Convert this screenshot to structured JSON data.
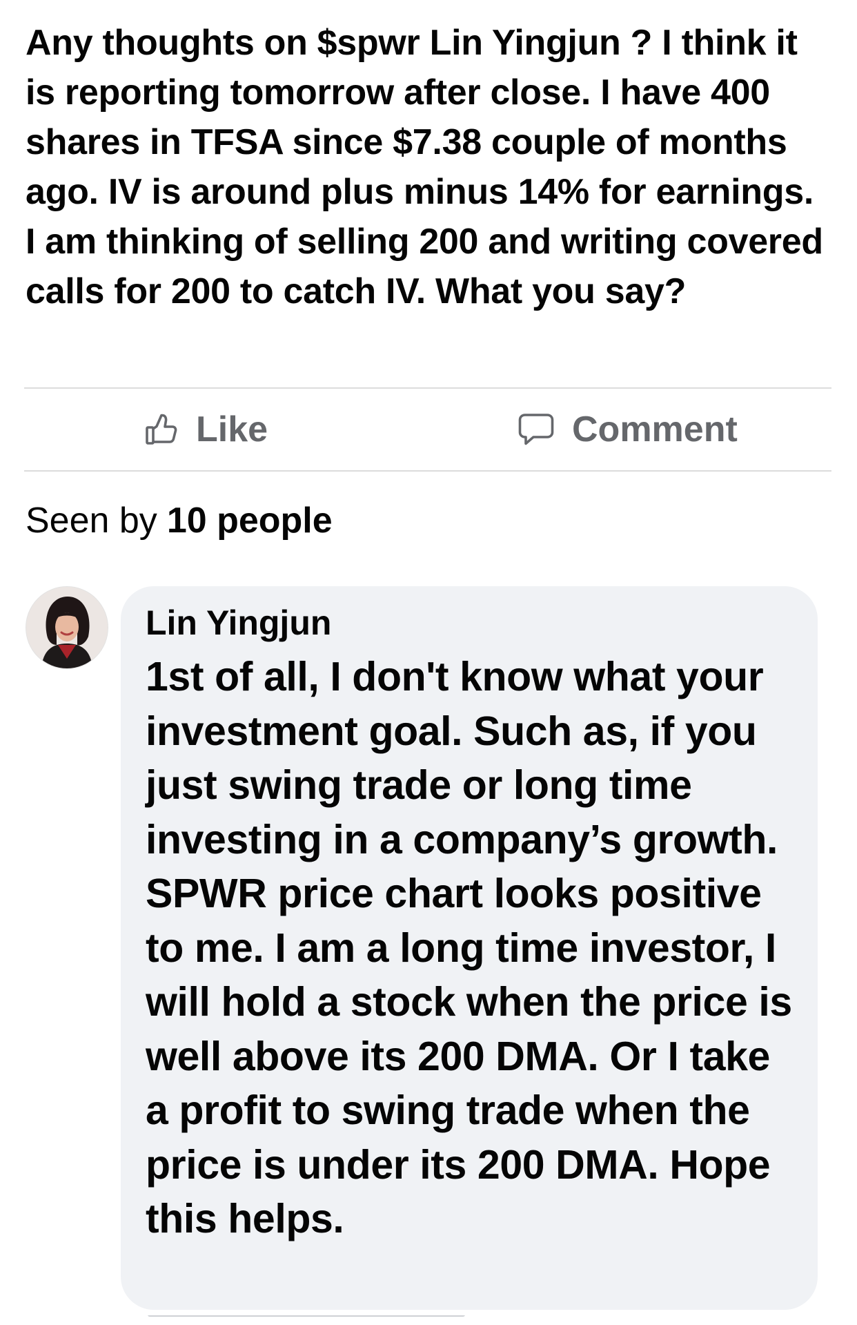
{
  "post": {
    "text_before_mention": "Any thoughts on $spwr ",
    "mention": "Lin Yingjun",
    "text_after_mention": " ? I think it is reporting tomorrow after close. I have 400 shares in TFSA since $7.38 couple of months ago. IV is around plus minus 14% for earnings. I am thinking of selling 200 and writing covered calls for 200 to catch IV. What you say?"
  },
  "actions": {
    "like_label": "Like",
    "like_icon": "thumbs-up-icon",
    "comment_label": "Comment",
    "comment_icon": "speech-bubble-icon"
  },
  "seen_by": {
    "label": "Seen by",
    "count": "10 people"
  },
  "comment": {
    "author": "Lin Yingjun",
    "avatar_icon": "profile-photo",
    "text": "1st of all, I don't know what your investment goal. Such as, if you just swing trade or long time investing in a company’s growth. SPWR price chart looks positive to me. I am a long time investor, I will hold a stock when the price is well above its 200 DMA. Or I take a profit to swing trade when the price is under its 200 DMA. Hope this helps."
  },
  "colors": {
    "text": "#050505",
    "secondary_text": "#65676b",
    "bubble_bg": "#f0f2f5",
    "divider": "#dcdcdc"
  }
}
